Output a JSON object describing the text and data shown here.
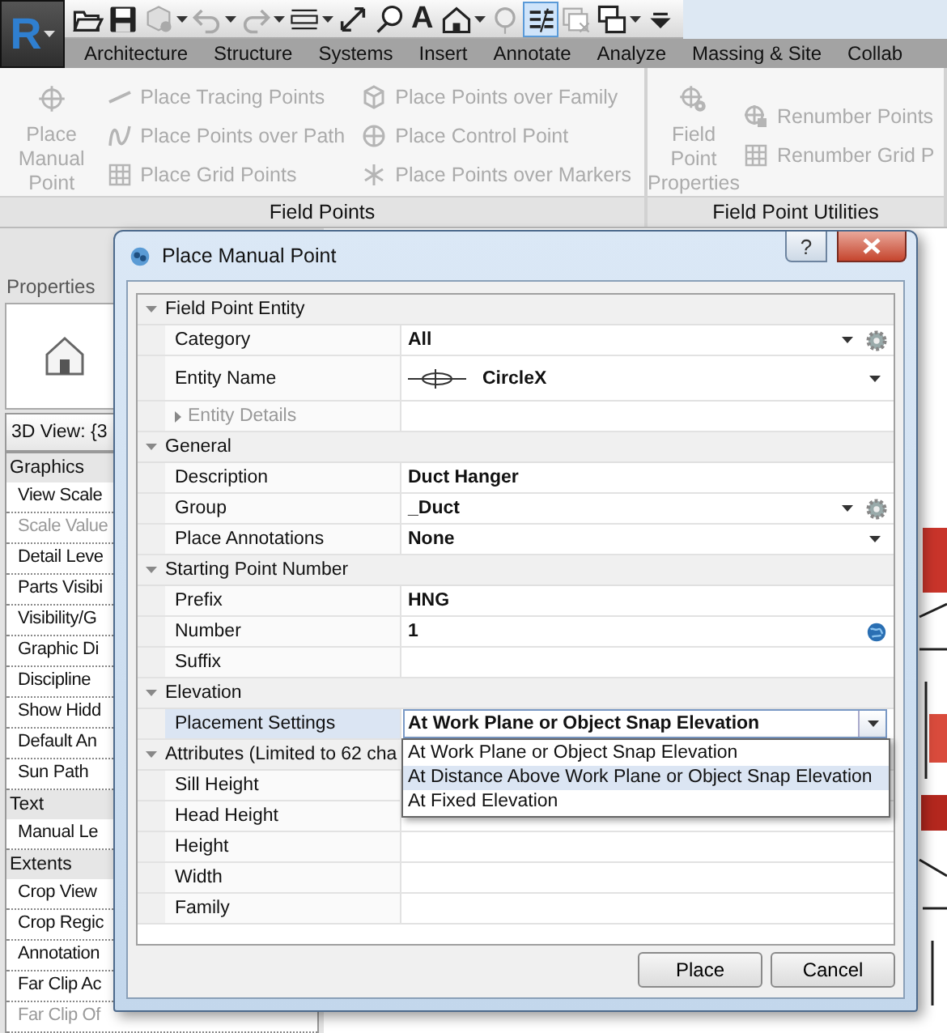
{
  "app_button": {
    "letter": "R"
  },
  "quick_access": [
    {
      "kind": "open",
      "disabled": false,
      "on": false,
      "dropdown": false
    },
    {
      "kind": "save",
      "disabled": false,
      "on": false,
      "dropdown": false
    },
    {
      "kind": "sync",
      "disabled": true,
      "on": false,
      "dropdown": true
    },
    {
      "kind": "undo",
      "disabled": true,
      "on": false,
      "dropdown": true
    },
    {
      "kind": "redo",
      "disabled": true,
      "on": false,
      "dropdown": true
    },
    {
      "kind": "align",
      "disabled": false,
      "on": false,
      "dropdown": true
    },
    {
      "kind": "measure",
      "disabled": false,
      "on": false,
      "dropdown": false
    },
    {
      "kind": "tag",
      "disabled": false,
      "on": false,
      "dropdown": false
    },
    {
      "kind": "text",
      "glyph": "A",
      "disabled": false,
      "on": false,
      "dropdown": false
    },
    {
      "kind": "house",
      "disabled": false,
      "on": false,
      "dropdown": true
    },
    {
      "kind": "pin",
      "disabled": true,
      "on": false,
      "dropdown": false
    },
    {
      "kind": "thinlines",
      "disabled": false,
      "on": true,
      "dropdown": false
    },
    {
      "kind": "closewin",
      "disabled": true,
      "on": false,
      "dropdown": false
    },
    {
      "kind": "switchwin",
      "disabled": false,
      "on": false,
      "dropdown": true
    },
    {
      "kind": "customize",
      "disabled": false,
      "on": false,
      "dropdown": false
    }
  ],
  "ribbon_tabs": [
    {
      "label": "Architecture",
      "selected": false
    },
    {
      "label": "Structure",
      "selected": false
    },
    {
      "label": "Systems",
      "selected": false
    },
    {
      "label": "Insert",
      "selected": false
    },
    {
      "label": "Annotate",
      "selected": false
    },
    {
      "label": "Analyze",
      "selected": false
    },
    {
      "label": "Massing & Site",
      "selected": false
    },
    {
      "label": "Collab",
      "selected": false
    }
  ],
  "ribbon_panels": [
    {
      "title": "Field Points",
      "large": {
        "label": [
          "Place",
          "Manual Point"
        ],
        "kind": "crosshair",
        "disabled": true
      },
      "columns": [
        [
          {
            "label": "Place Tracing Points",
            "kind": "trace",
            "disabled": true
          },
          {
            "label": "Place Points over Path",
            "kind": "path",
            "disabled": true
          },
          {
            "label": "Place Grid Points",
            "kind": "grid",
            "disabled": true
          }
        ],
        [
          {
            "label": "Place Points over Family",
            "kind": "cube",
            "disabled": true
          },
          {
            "label": "Place Control Point",
            "kind": "target",
            "disabled": true
          },
          {
            "label": "Place Points over Markers",
            "kind": "asterisk",
            "disabled": true
          }
        ]
      ]
    },
    {
      "title": "Field Point Utilities",
      "large": {
        "label": [
          "Field Point",
          "Properties"
        ],
        "kind": "crosshair-gear",
        "disabled": true
      },
      "columns": [
        [
          {
            "label": "Renumber Points",
            "kind": "renumber",
            "disabled": true
          },
          {
            "label": "Renumber Grid P",
            "kind": "grid",
            "disabled": true
          }
        ]
      ]
    }
  ],
  "properties": {
    "title": "Properties",
    "type_selector": "3D View: {3",
    "groups": [
      {
        "name": "Graphics",
        "rows": [
          {
            "label": "View Scale",
            "disabled": false
          },
          {
            "label": "Scale Value",
            "disabled": true
          },
          {
            "label": "Detail Leve",
            "disabled": false
          },
          {
            "label": "Parts Visibi",
            "disabled": false
          },
          {
            "label": "Visibility/G",
            "disabled": false
          },
          {
            "label": "Graphic Di",
            "disabled": false
          },
          {
            "label": "Discipline",
            "disabled": false
          },
          {
            "label": "Show Hidd",
            "disabled": false
          },
          {
            "label": "Default An",
            "disabled": false
          },
          {
            "label": "Sun Path",
            "disabled": false
          }
        ]
      },
      {
        "name": "Text",
        "rows": [
          {
            "label": "Manual Le",
            "disabled": false
          }
        ]
      },
      {
        "name": "Extents",
        "rows": [
          {
            "label": "Crop View",
            "disabled": false
          },
          {
            "label": "Crop Regic",
            "disabled": false
          },
          {
            "label": "Annotation",
            "disabled": false
          },
          {
            "label": "Far Clip Ac",
            "disabled": false
          },
          {
            "label": "Far Clip Of",
            "disabled": true
          }
        ]
      }
    ]
  },
  "dialog": {
    "title": "Place Manual Point",
    "help": "?",
    "categories": [
      {
        "name": "Field Point Entity",
        "expanded": true,
        "rows": [
          {
            "kind": "dropdown-gear",
            "label": "Category",
            "value": "All",
            "open": false,
            "selected": false
          },
          {
            "kind": "symbol-dropdown",
            "label": "Entity Name",
            "value": "CircleX",
            "open": false,
            "selected": false
          },
          {
            "kind": "subgroup",
            "label": "Entity Details",
            "expanded": false,
            "disabled": true
          }
        ]
      },
      {
        "name": "General",
        "expanded": true,
        "rows": [
          {
            "kind": "text",
            "label": "Description",
            "value": "Duct Hanger",
            "selected": false
          },
          {
            "kind": "dropdown-gear",
            "label": "Group",
            "value": "_Duct",
            "open": false,
            "selected": false
          },
          {
            "kind": "dropdown",
            "label": "Place Annotations",
            "value": "None",
            "open": false,
            "selected": false
          }
        ]
      },
      {
        "name": "Starting Point Number",
        "expanded": true,
        "rows": [
          {
            "kind": "text",
            "label": "Prefix",
            "value": "HNG",
            "selected": false
          },
          {
            "kind": "text-globe",
            "label": "Number",
            "value": "1",
            "selected": false
          },
          {
            "kind": "text",
            "label": "Suffix",
            "selected": false
          }
        ]
      },
      {
        "name": "Elevation",
        "expanded": true,
        "rows": [
          {
            "kind": "dropdown",
            "label": "Placement Settings",
            "value": "At Work Plane or Object Snap Elevation",
            "open": true,
            "selected": true,
            "options": [
              {
                "label": "At Work Plane or Object Snap Elevation",
                "highlighted": false
              },
              {
                "label": "At Distance Above Work Plane or Object Snap Elevation",
                "highlighted": true
              },
              {
                "label": "At Fixed Elevation",
                "highlighted": false
              }
            ]
          }
        ]
      },
      {
        "name": "Attributes (Limited to 62 cha",
        "expanded": true,
        "rows": [
          {
            "kind": "text",
            "label": "Sill Height",
            "selected": false
          },
          {
            "kind": "text",
            "label": "Head Height",
            "selected": false
          },
          {
            "kind": "text",
            "label": "Height",
            "selected": false
          },
          {
            "kind": "text",
            "label": "Width",
            "selected": false
          },
          {
            "kind": "text",
            "label": "Family",
            "selected": false
          }
        ]
      }
    ],
    "buttons": [
      {
        "label": "Place"
      },
      {
        "label": "Cancel"
      }
    ]
  }
}
